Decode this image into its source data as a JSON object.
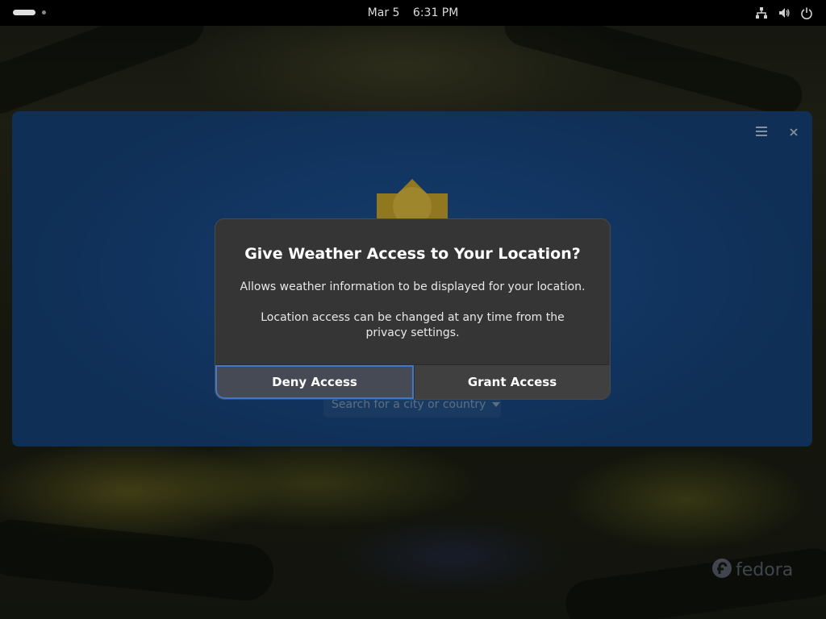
{
  "topbar": {
    "date": "Mar 5",
    "time": "6:31 PM",
    "icons": [
      "network-icon",
      "volume-icon",
      "power-icon"
    ]
  },
  "weather_window": {
    "search_placeholder": "Search for a city or country",
    "menu_icon": "hamburger-menu-icon",
    "close_icon": "close-icon"
  },
  "dialog": {
    "title": "Give Weather Access to Your Location?",
    "body_line1": "Allows weather information to be displayed for your location.",
    "body_line2": "Location access can be changed at any time from the privacy settings.",
    "deny_label": "Deny Access",
    "grant_label": "Grant Access"
  },
  "wallpaper": {
    "logo_text": "fedora"
  },
  "colors": {
    "dialog_bg": "#353535",
    "weather_bg": "#1f5aa3",
    "focus_ring": "#3f78c8"
  }
}
